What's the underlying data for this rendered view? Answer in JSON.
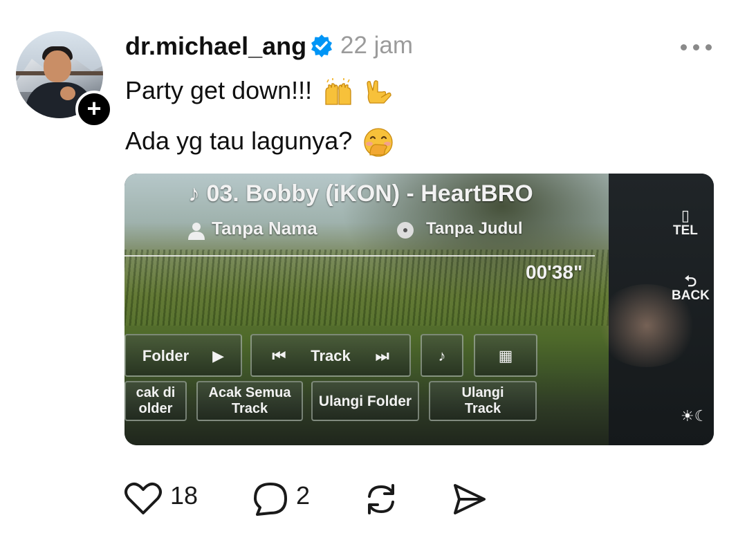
{
  "post": {
    "username": "dr.michael_ang",
    "time": "22 jam",
    "line1": "Party get down!!!",
    "line2": "Ada yg tau lagunya?",
    "emojis_line1": [
      "raising-hands",
      "love-you-gesture"
    ],
    "emoji_line2": "face-with-hand-over-mouth"
  },
  "media": {
    "song_title": "♪ 03. Bobby (iKON) - HeartBRO",
    "artist": "Tanpa Nama",
    "album": "Tanpa Judul",
    "elapsed": "00'38\"",
    "buttons": {
      "folder": "Folder",
      "track": "Track",
      "random_folder": "cak di\nolder",
      "random_all": "Acak Semua\nTrack",
      "repeat_folder": "Ulangi Folder",
      "repeat_track": "Ulangi\nTrack"
    },
    "side": {
      "tel": "TEL",
      "back": "BACK"
    }
  },
  "actions": {
    "likes": "18",
    "replies": "2"
  },
  "colors": {
    "verified": "#0095f6",
    "muted": "#9b9b9b"
  }
}
